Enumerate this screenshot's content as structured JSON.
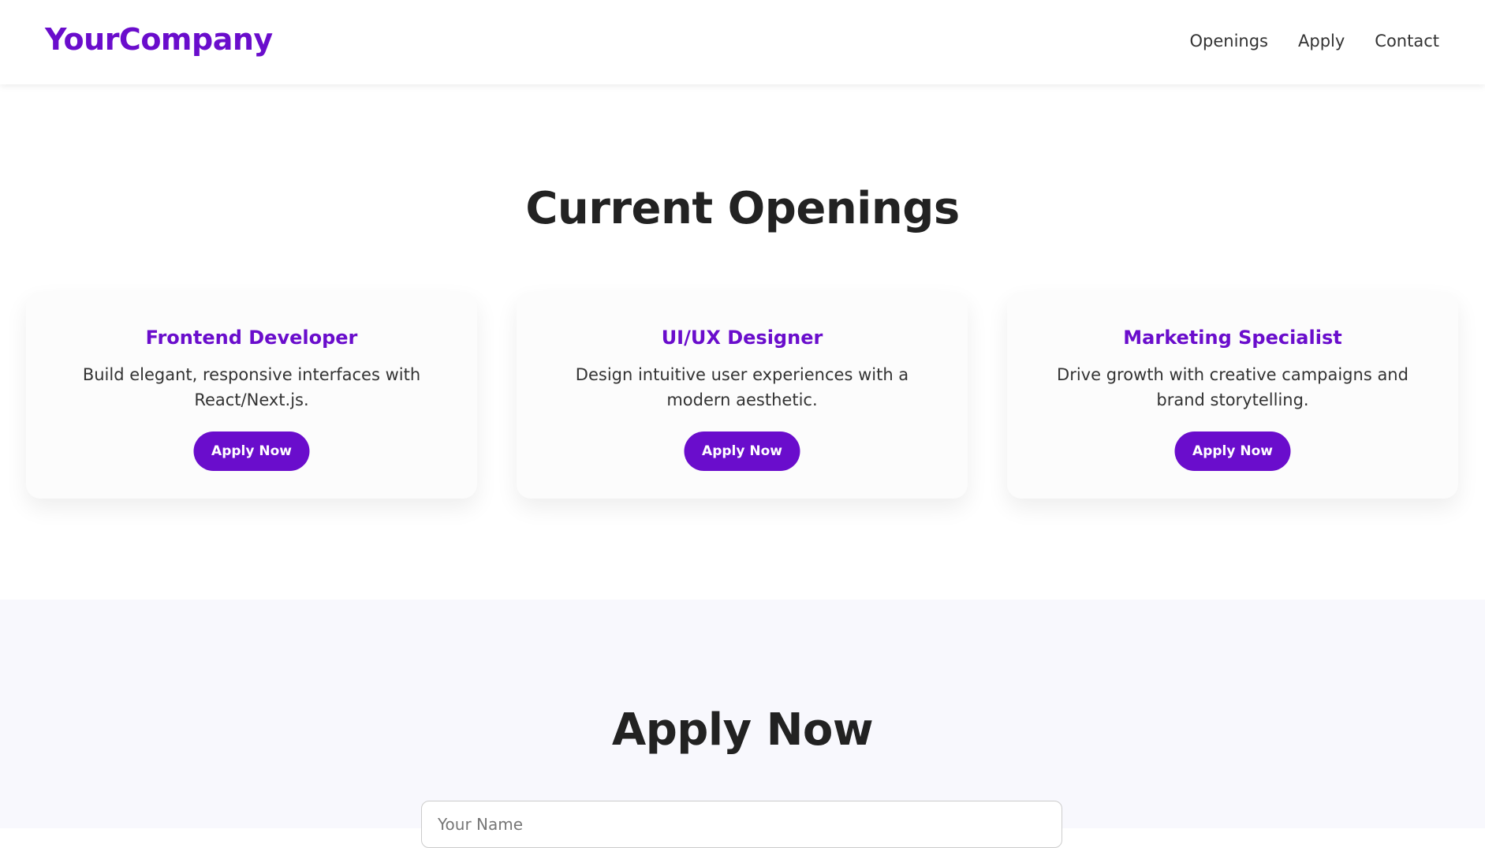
{
  "header": {
    "logo": "YourCompany",
    "nav": [
      "Openings",
      "Apply",
      "Contact"
    ]
  },
  "openings": {
    "title": "Current Openings",
    "cards": [
      {
        "title": "Frontend Developer",
        "description": "Build elegant, responsive interfaces with React/Next.js.",
        "button": "Apply Now"
      },
      {
        "title": "UI/UX Designer",
        "description": "Design intuitive user experiences with a modern aesthetic.",
        "button": "Apply Now"
      },
      {
        "title": "Marketing Specialist",
        "description": "Drive growth with creative campaigns and brand storytelling.",
        "button": "Apply Now"
      }
    ]
  },
  "apply": {
    "title": "Apply Now",
    "name_placeholder": "Your Name"
  },
  "colors": {
    "accent": "#6a0dcc",
    "text": "#222222",
    "apply_bg": "#f8f8fd"
  }
}
